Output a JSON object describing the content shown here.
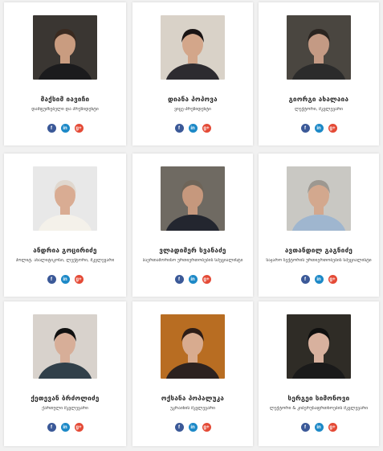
{
  "cards": [
    {
      "name": "მაქსიმ იავიჩი",
      "role": "დამფუძნებელი და პრეზიდენტი",
      "photo": {
        "bg": "#3a3632",
        "shirt": "#1b1b1d",
        "skin": "#c99c80",
        "hair": "#3a2a20"
      }
    },
    {
      "name": "დიანა პოპოვა",
      "role": "ვიცე-პრეზიდენტი",
      "photo": {
        "bg": "#d9d2c8",
        "shirt": "#2d2b30",
        "skin": "#d3a68a",
        "hair": "#1a1414"
      }
    },
    {
      "name": "გიორგი ახალაია",
      "role": "ლექტორი, მკვლევარი",
      "photo": {
        "bg": "#4a4640",
        "shirt": "#2b2b2b",
        "skin": "#c49a84",
        "hair": "#2a2420"
      }
    },
    {
      "name": "ანდრია გოცირიძე",
      "role": "პოლიტ. ანალიტიკოსი, ლექტორი, მკვლევარი",
      "photo": {
        "bg": "#e8e8e8",
        "shirt": "#f4f1ea",
        "skin": "#d9ac93",
        "hair": "#e0d8cf"
      }
    },
    {
      "name": "ვლადიმერ სვანაძე",
      "role": "საერთაშორისო ურთიერთობების სპეციალისტი",
      "photo": {
        "bg": "#6f6a62",
        "shirt": "#23262f",
        "skin": "#c6987d",
        "hair": "#6e6458"
      }
    },
    {
      "name": "ავთანდილ გაგნიძე",
      "role": "საჯარო სექტორის ურთიერთობების სპეციალისტი",
      "photo": {
        "bg": "#c9c8c3",
        "shirt": "#9fb6cf",
        "skin": "#d3a88e",
        "hair": "#9d9891"
      }
    },
    {
      "name": "ქეთევან ბრძოლიძე",
      "role": "ქართული მკვლევარი",
      "photo": {
        "bg": "#d8d2cc",
        "shirt": "#31404a",
        "skin": "#d7ae98",
        "hair": "#111111"
      }
    },
    {
      "name": "ოქსანა პოპალუკა",
      "role": "უკრაინის მკვლევარი",
      "photo": {
        "bg": "#b86d22",
        "shirt": "#2c2220",
        "skin": "#d8ab8f",
        "hair": "#2d1d17"
      }
    },
    {
      "name": "სერგეი სიმონოვი",
      "role": "ლექტორი & კიბერუსაფრთხოების მკვლევარი",
      "photo": {
        "bg": "#2f2c26",
        "shirt": "#1a1a1a",
        "skin": "#d8b19e",
        "hair": "#0f0f0f"
      }
    }
  ],
  "social": {
    "facebook": "f",
    "linkedin": "in",
    "googleplus": "g+"
  }
}
